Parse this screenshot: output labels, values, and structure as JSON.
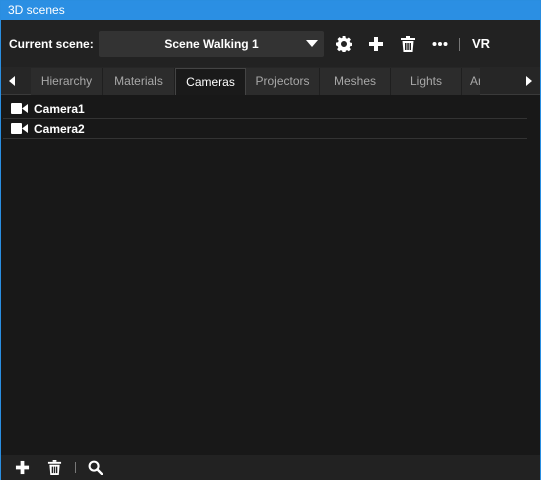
{
  "window": {
    "title": "3D scenes"
  },
  "toolbar": {
    "current_scene_label": "Current scene:",
    "scene_value": "Scene Walking 1",
    "vr_label": "VR",
    "icons": [
      "gear-icon",
      "plus-icon",
      "trash-icon",
      "more-icon"
    ]
  },
  "tabs": [
    {
      "label": "Hierarchy"
    },
    {
      "label": "Materials"
    },
    {
      "label": "Cameras",
      "active": true
    },
    {
      "label": "Projectors"
    },
    {
      "label": "Meshes"
    },
    {
      "label": "Lights"
    },
    {
      "label": "Ar"
    }
  ],
  "cameras": [
    {
      "name": "Camera1",
      "icon": "video-camera-icon"
    },
    {
      "name": "Camera2",
      "icon": "video-camera-icon"
    }
  ],
  "footer": {
    "icons": [
      "plus-icon",
      "trash-icon",
      "search-icon"
    ]
  },
  "colors": {
    "accent": "#2b8fe3",
    "background": "#181818",
    "panel": "#222222"
  }
}
